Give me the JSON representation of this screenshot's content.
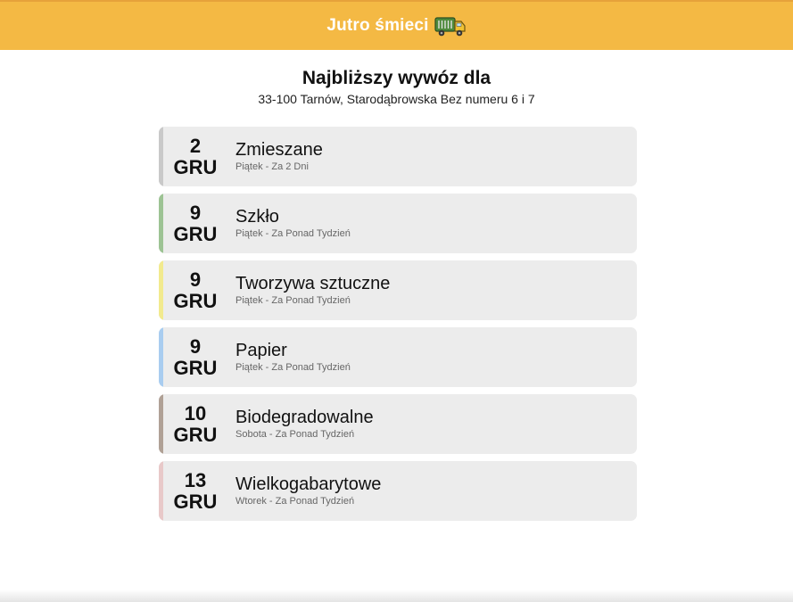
{
  "header": {
    "title": "Jutro śmieci",
    "icon": "garbage-truck-icon",
    "background": "#f4b944"
  },
  "main": {
    "title": "Najbliższy wywóz dla",
    "address": "33-100 Tarnów, Starodąbrowska Bez numeru 6 i 7"
  },
  "pickups": [
    {
      "day": "2",
      "month": "GRU",
      "name": "Zmieszane",
      "when": "Piątek - Za 2 Dni",
      "color": "#c9c9c9"
    },
    {
      "day": "9",
      "month": "GRU",
      "name": "Szkło",
      "when": "Piątek - Za Ponad Tydzień",
      "color": "#9dc394"
    },
    {
      "day": "9",
      "month": "GRU",
      "name": "Tworzywa sztuczne",
      "when": "Piątek - Za Ponad Tydzień",
      "color": "#f2ea8e"
    },
    {
      "day": "9",
      "month": "GRU",
      "name": "Papier",
      "when": "Piątek - Za Ponad Tydzień",
      "color": "#a9cdf0"
    },
    {
      "day": "10",
      "month": "GRU",
      "name": "Biodegradowalne",
      "when": "Sobota - Za Ponad Tydzień",
      "color": "#b0a196"
    },
    {
      "day": "13",
      "month": "GRU",
      "name": "Wielkogabarytowe",
      "when": "Wtorek - Za Ponad Tydzień",
      "color": "#e8c9c9"
    }
  ]
}
